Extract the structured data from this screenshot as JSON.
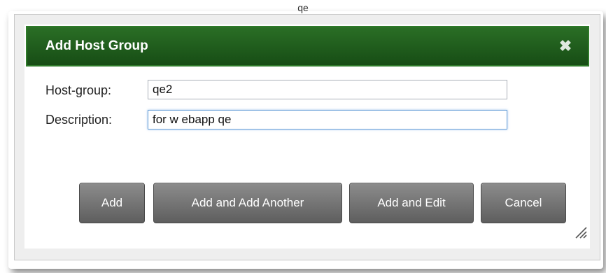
{
  "background": {
    "page_text": "qe"
  },
  "dialog": {
    "title": "Add Host Group",
    "close_icon": "close-icon",
    "fields": [
      {
        "label": "Host-group:",
        "value": "qe2",
        "placeholder": ""
      },
      {
        "label": "Description:",
        "value": "for w ebapp qe",
        "placeholder": ""
      }
    ],
    "buttons": {
      "add": "Add",
      "add_another": "Add and Add Another",
      "add_edit": "Add and Edit",
      "cancel": "Cancel"
    },
    "resize_icon": "resize-grip-icon"
  },
  "colors": {
    "titlebar": "#1d5a1b",
    "button": "#6e6e6e",
    "dialog_bg": "#eeeeee"
  }
}
